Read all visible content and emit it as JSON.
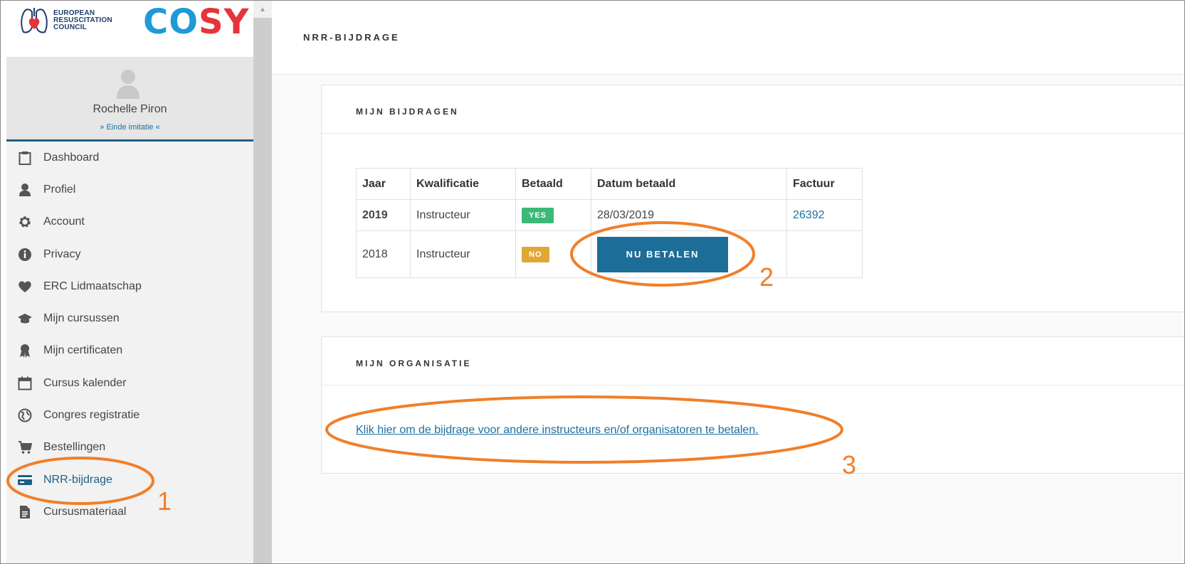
{
  "brand": {
    "erc_lines": [
      "EUROPEAN",
      "RESUSCITATION",
      "COUNCIL"
    ],
    "cosy_co": "CO",
    "cosy_sy": "SY"
  },
  "user": {
    "name": "Rochelle Piron",
    "end_impersonation": "» Einde imitatie «"
  },
  "sidebar": {
    "items": [
      {
        "label": "Dashboard",
        "icon": "clipboard-icon"
      },
      {
        "label": "Profiel",
        "icon": "user-icon"
      },
      {
        "label": "Account",
        "icon": "gear-icon"
      },
      {
        "label": "Privacy",
        "icon": "info-icon"
      },
      {
        "label": "ERC Lidmaatschap",
        "icon": "heart-icon"
      },
      {
        "label": "Mijn cursussen",
        "icon": "graduation-cap-icon"
      },
      {
        "label": "Mijn certificaten",
        "icon": "award-icon"
      },
      {
        "label": "Cursus kalender",
        "icon": "calendar-icon"
      },
      {
        "label": "Congres registratie",
        "icon": "globe-icon"
      },
      {
        "label": "Bestellingen",
        "icon": "cart-icon"
      },
      {
        "label": "NRR-bijdrage",
        "icon": "credit-card-icon"
      },
      {
        "label": "Cursusmateriaal",
        "icon": "document-icon"
      }
    ],
    "active_index": 10
  },
  "page": {
    "title": "NRR-BIJDRAGE"
  },
  "contributions": {
    "title": "MIJN BIJDRAGEN",
    "headers": [
      "Jaar",
      "Kwalificatie",
      "Betaald",
      "Datum betaald",
      "Factuur"
    ],
    "rows": [
      {
        "year": "2019",
        "qualification": "Instructeur",
        "paid": "YES",
        "date": "28/03/2019",
        "invoice": "26392"
      },
      {
        "year": "2018",
        "qualification": "Instructeur",
        "paid": "NO",
        "pay_button": "NU BETALEN"
      }
    ]
  },
  "organisation": {
    "title": "MIJN ORGANISATIE",
    "link": "Klik hier om de bijdrage voor andere instructeurs en/of organisatoren te betalen."
  },
  "annotations": [
    "1",
    "2",
    "3"
  ],
  "colors": {
    "primary": "#1d6d99",
    "annotation": "#f07f2a",
    "yes": "#3cb878",
    "no": "#e0a736"
  }
}
